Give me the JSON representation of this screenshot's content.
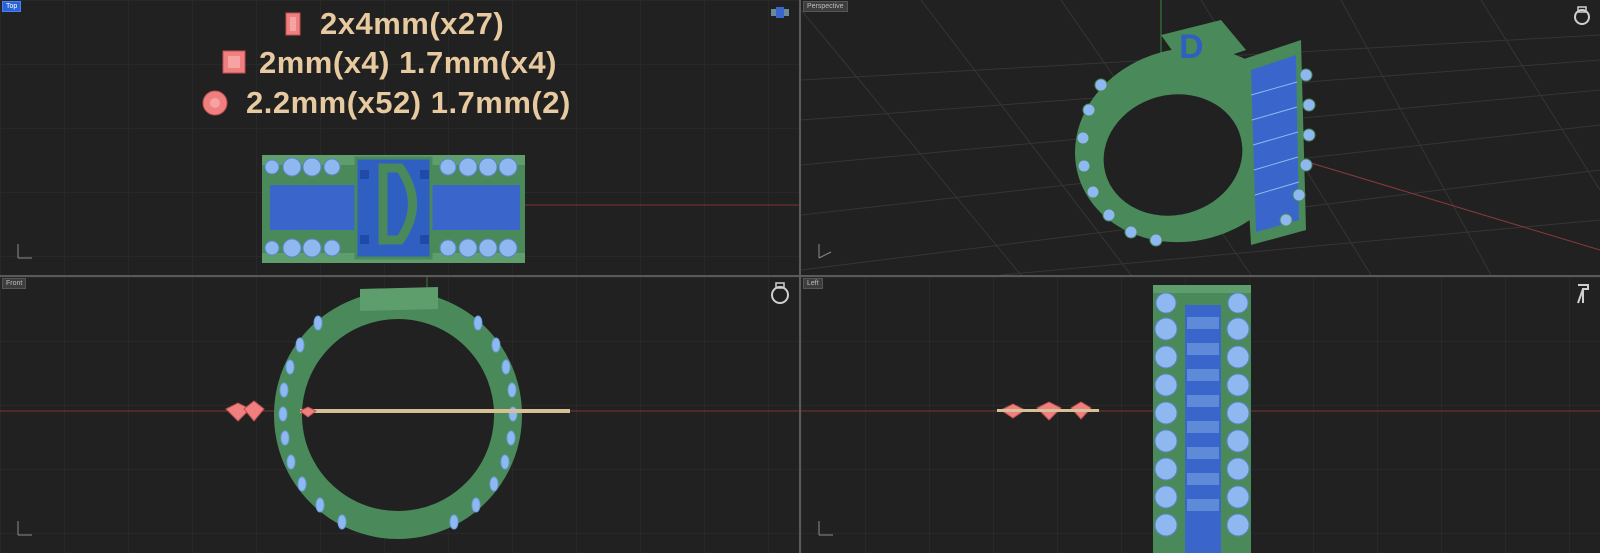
{
  "viewports": {
    "top": {
      "label": "Top"
    },
    "perspective": {
      "label": "Perspective"
    },
    "front": {
      "label": "Front"
    },
    "left": {
      "label": "Left"
    }
  },
  "legend": [
    {
      "shape": "baguette",
      "text": "2x4mm(x27)"
    },
    {
      "shape": "princess",
      "text": "2mm(x4) 1.7mm(x4)"
    },
    {
      "shape": "round",
      "text": "2.2mm(x52) 1.7mm(2)"
    }
  ],
  "colors": {
    "viewport_bg": "#212121",
    "grid": "#2e2e2e",
    "grid_major": "#3a3a3a",
    "axis_x": "#8a3a3a",
    "axis_y": "#3a8a3a",
    "metal": "#4a8a5a",
    "metal_light": "#6aaa78",
    "gem_blue": "#3a66cc",
    "gem_light": "#8fb8f0",
    "legend_text": "#e7caa0",
    "legend_gem": "#f08080",
    "active_label": "#2a63d6"
  },
  "icons": {
    "top": "ring-top-icon",
    "perspective": "ring-perspective-icon",
    "front": "ring-front-icon",
    "left": "ring-side-icon"
  }
}
